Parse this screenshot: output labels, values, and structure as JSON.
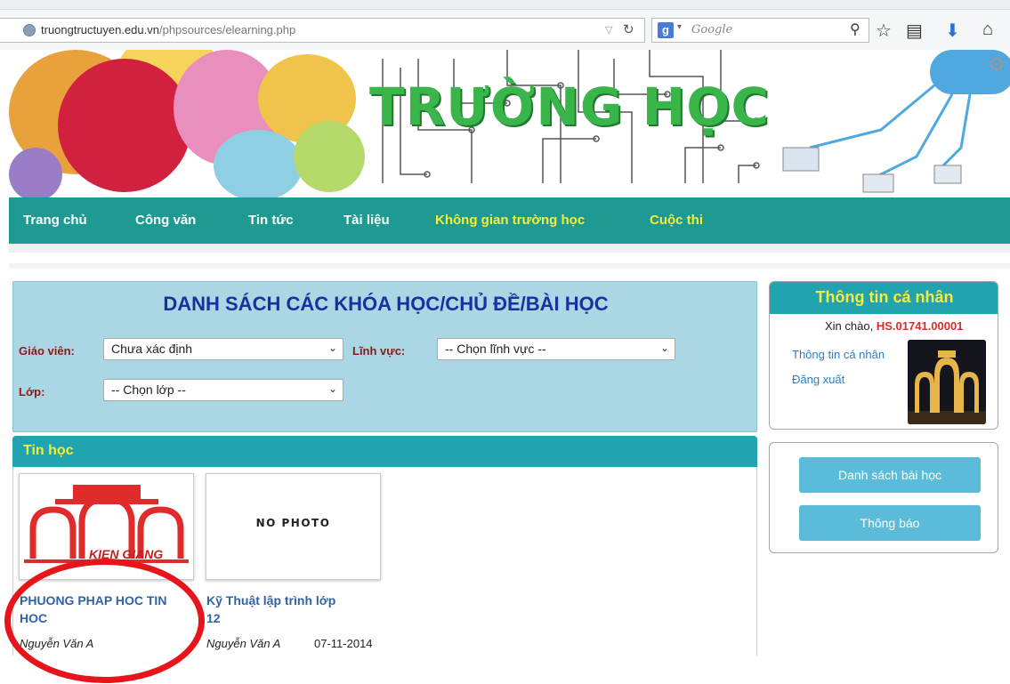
{
  "browser": {
    "url_domain": "truongtructuyen.edu.vn",
    "url_path": "/phpsources/elearning.php",
    "search_placeholder": "Google"
  },
  "banner": {
    "title": "TRƯỜNG HỌC"
  },
  "nav": {
    "items": [
      {
        "label": "Trang chủ"
      },
      {
        "label": "Công văn"
      },
      {
        "label": "Tin tức"
      },
      {
        "label": "Tài liệu"
      },
      {
        "label": "Không gian trường học"
      },
      {
        "label": "Cuộc thi"
      }
    ]
  },
  "filters": {
    "title": "DANH SÁCH CÁC KHÓA HỌC/CHỦ ĐỀ/BÀI HỌC",
    "teacher_label": "Giáo viên:",
    "teacher_value": "Chưa xác định",
    "field_label": "Lĩnh vực:",
    "field_value": "-- Chọn lĩnh vực --",
    "class_label": "Lớp:",
    "class_value": "-- Chọn lớp --"
  },
  "category": {
    "title": "Tin học",
    "courses": [
      {
        "title_line1": "PHUONG PHAP HOC TIN",
        "title_line2": "HOC",
        "author": "Nguyễn Văn A",
        "logo_text": "KIEN GIANG"
      },
      {
        "thumb_text": "NO PHOTO",
        "title_line1": "Kỹ Thuật lập trình lớp",
        "title_line2": "12",
        "author": "Nguyễn Văn A",
        "date": "07-11-2014"
      }
    ]
  },
  "profile": {
    "title": "Thông tin cá nhân",
    "greeting": "Xin chào, ",
    "user_id": "HS.01741.00001",
    "link_info": "Thông tin cá nhân",
    "link_logout": "Đăng xuất"
  },
  "actions": {
    "lessons_button": "Danh sách bài học",
    "notify_button": "Thông báo"
  },
  "colors": {
    "nav_bg": "#1f9a92",
    "accent_yellow": "#f4ee3a",
    "panel_blue": "#aad7e3",
    "button_blue": "#5bbcd9",
    "highlight_red": "#e8141c"
  }
}
